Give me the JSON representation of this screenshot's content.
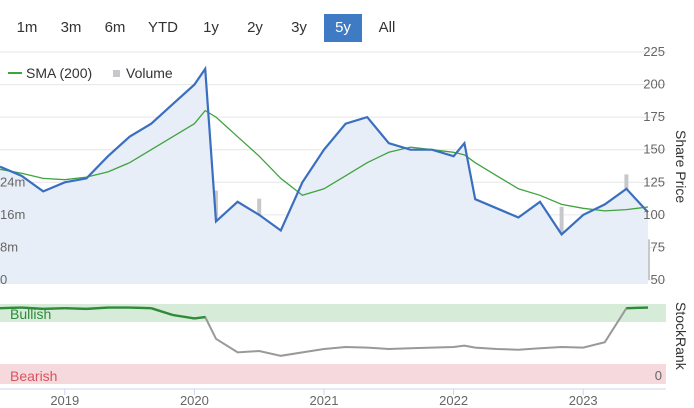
{
  "range_selector": {
    "options": [
      "1m",
      "3m",
      "6m",
      "YTD",
      "1y",
      "2y",
      "3y",
      "5y",
      "All"
    ],
    "selected": "5y",
    "active_color": "#3f7ac4"
  },
  "legend": {
    "sma_label": "SMA (200)",
    "volume_label": "Volume"
  },
  "colors": {
    "price": "#3a6fc0",
    "price_fill": "#e8eef7",
    "sma": "#3fa33f",
    "volume": "#c8c8cc",
    "rank_line": "#999999",
    "rank_bullish": "#2e8b3a",
    "bullish_band": "#d6ecd8",
    "bearish_band": "#f6d9dc",
    "bearish_text": "#d9535f",
    "bullish_text": "#2e8b3a"
  },
  "chart_data": [
    {
      "type": "line",
      "title": "",
      "ylabel": "Share Price",
      "ylim": [
        50,
        225
      ],
      "yticks": [
        225,
        200,
        175,
        150,
        125,
        100,
        75,
        50
      ],
      "volume_ticks": [
        "24m",
        "16m",
        "8m",
        "0"
      ],
      "volume_ylim": [
        0,
        32
      ],
      "xticks": [
        "2019",
        "2020",
        "2021",
        "2022",
        "2023"
      ],
      "x": [
        "2018-07",
        "2018-09",
        "2018-11",
        "2019-01",
        "2019-03",
        "2019-05",
        "2019-07",
        "2019-09",
        "2019-11",
        "2020-01",
        "2020-02",
        "2020-03",
        "2020-05",
        "2020-07",
        "2020-09",
        "2020-11",
        "2021-01",
        "2021-03",
        "2021-05",
        "2021-07",
        "2021-09",
        "2021-11",
        "2022-01",
        "2022-02",
        "2022-03",
        "2022-05",
        "2022-07",
        "2022-09",
        "2022-11",
        "2023-01",
        "2023-03",
        "2023-05",
        "2023-07"
      ],
      "series": [
        {
          "name": "",
          "values": [
            137,
            130,
            118,
            125,
            128,
            145,
            160,
            170,
            185,
            200,
            212,
            95,
            110,
            100,
            88,
            125,
            150,
            170,
            175,
            155,
            150,
            150,
            145,
            155,
            112,
            105,
            98,
            110,
            85,
            100,
            108,
            120,
            102
          ]
        },
        {
          "name": "SMA (200)",
          "values": [
            135,
            132,
            128,
            127,
            129,
            133,
            140,
            150,
            160,
            170,
            180,
            175,
            160,
            145,
            128,
            115,
            120,
            130,
            140,
            148,
            152,
            150,
            148,
            146,
            140,
            130,
            120,
            115,
            108,
            105,
            103,
            104,
            106
          ]
        },
        {
          "name": "Volume",
          "values": [
            3,
            4,
            3,
            5,
            4,
            3,
            4,
            5,
            5,
            4,
            8,
            22,
            7,
            20,
            8,
            6,
            7,
            10,
            6,
            23,
            5,
            8,
            14,
            7,
            5,
            6,
            5,
            5,
            18,
            7,
            12,
            26,
            10
          ]
        }
      ]
    },
    {
      "type": "line",
      "title": "",
      "ylabel": "StockRank",
      "band_labels": {
        "top": "Bullish",
        "bottom": "Bearish"
      },
      "yticks": [
        0
      ],
      "ylim": [
        0,
        100
      ],
      "x": [
        "2018-07",
        "2018-09",
        "2018-11",
        "2019-01",
        "2019-03",
        "2019-05",
        "2019-07",
        "2019-09",
        "2019-11",
        "2020-01",
        "2020-02",
        "2020-03",
        "2020-05",
        "2020-07",
        "2020-09",
        "2020-11",
        "2021-01",
        "2021-03",
        "2021-05",
        "2021-07",
        "2021-09",
        "2021-11",
        "2022-01",
        "2022-02",
        "2022-03",
        "2022-05",
        "2022-07",
        "2022-09",
        "2022-11",
        "2023-01",
        "2023-03",
        "2023-05",
        "2023-07"
      ],
      "series": [
        {
          "name": "",
          "values": [
            85,
            86,
            84,
            85,
            84,
            86,
            86,
            85,
            75,
            70,
            72,
            40,
            20,
            22,
            15,
            20,
            25,
            28,
            27,
            25,
            26,
            27,
            28,
            30,
            27,
            25,
            24,
            26,
            28,
            27,
            35,
            85,
            86
          ]
        }
      ]
    }
  ]
}
